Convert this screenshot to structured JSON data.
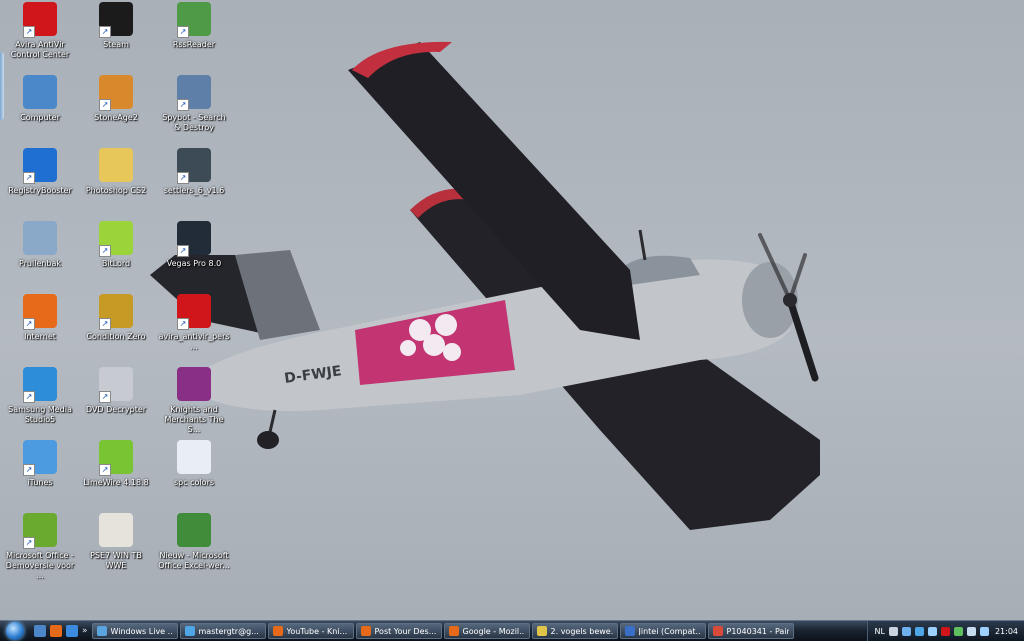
{
  "desktop": {
    "icons": [
      {
        "label": "Avira AntiVir Control Center",
        "icon": "avira-umbrella-icon",
        "color": "#d0151b",
        "shortcut": true
      },
      {
        "label": "Steam",
        "icon": "steam-icon",
        "color": "#1b1b1b",
        "shortcut": true
      },
      {
        "label": "RssReader",
        "icon": "rss-reader-icon",
        "color": "#4f9a46",
        "shortcut": true
      },
      {
        "label": "Computer",
        "icon": "computer-icon",
        "color": "#4b88c9",
        "shortcut": false
      },
      {
        "label": "StoneAge2",
        "icon": "stoneage-icon",
        "color": "#d9892b",
        "shortcut": true
      },
      {
        "label": "Spybot - Search & Destroy",
        "icon": "spybot-icon",
        "color": "#5e7fa7",
        "shortcut": true
      },
      {
        "label": "RegistryBooster",
        "icon": "registry-booster-icon",
        "color": "#1e6fd1",
        "shortcut": true
      },
      {
        "label": "Photoshop CS2",
        "icon": "folder-icon",
        "color": "#e8c75a",
        "shortcut": false
      },
      {
        "label": "settlers_6_v1.6",
        "icon": "settlers-shield-icon",
        "color": "#3d4b57",
        "shortcut": true
      },
      {
        "label": "Prullenbak",
        "icon": "recycle-bin-icon",
        "color": "#8aa8c8",
        "shortcut": false
      },
      {
        "label": "BitLord",
        "icon": "bitlord-icon",
        "color": "#9ad43a",
        "shortcut": true
      },
      {
        "label": "Vegas Pro 8.0",
        "icon": "vegas-icon",
        "color": "#222c38",
        "shortcut": true
      },
      {
        "label": "Internet",
        "icon": "firefox-icon",
        "color": "#e66a1a",
        "shortcut": true
      },
      {
        "label": "Condition Zero",
        "icon": "counter-strike-icon",
        "color": "#c79a25",
        "shortcut": true
      },
      {
        "label": "avira_antivir_pers...",
        "icon": "avira-umbrella-icon",
        "color": "#d0151b",
        "shortcut": true
      },
      {
        "label": "Samsung Media Studio5",
        "icon": "samsung-media-icon",
        "color": "#2d8dd8",
        "shortcut": true
      },
      {
        "label": "DVD Decrypter",
        "icon": "dvd-icon",
        "color": "#c7cbd1",
        "shortcut": true
      },
      {
        "label": "Knights and Merchants The S...",
        "icon": "winrar-archive-icon",
        "color": "#8a2f86",
        "shortcut": false
      },
      {
        "label": "iTunes",
        "icon": "itunes-icon",
        "color": "#4c9be0",
        "shortcut": true
      },
      {
        "label": "LimeWire 4.18.8",
        "icon": "limewire-icon",
        "color": "#79c432",
        "shortcut": true
      },
      {
        "label": "spc colors",
        "icon": "text-document-icon",
        "color": "#e9eef5",
        "shortcut": false
      },
      {
        "label": "Microsoft Office - Demoversie voor ...",
        "icon": "office-icon",
        "color": "#6aaa2f",
        "shortcut": true
      },
      {
        "label": "PSE7 WIN TB WWE",
        "icon": "adobe-box-icon",
        "color": "#e6e3dc",
        "shortcut": false
      },
      {
        "label": "Nieuw - Microsoft Office Excel-wer...",
        "icon": "excel-icon",
        "color": "#3f8d3a",
        "shortcut": false
      }
    ]
  },
  "wallpaper": {
    "subject": "biplane",
    "registration": "D-FWJE",
    "colors": {
      "sky": "#aeb4bb",
      "fuselage": "#c3c7cb",
      "wing": "#2a2a30",
      "wingtip": "#c0303c",
      "livery": "#c23572"
    }
  },
  "taskbar": {
    "quick_launch": [
      {
        "icon": "show-desktop-icon",
        "color": "#4b86c8"
      },
      {
        "icon": "firefox-icon",
        "color": "#e66a1a"
      },
      {
        "icon": "internet-explorer-icon",
        "color": "#3a8be0"
      }
    ],
    "overflow": "»",
    "tasks": [
      {
        "label": "Windows Live ...",
        "icon": "msn-icon",
        "color": "#5aa5e0"
      },
      {
        "label": "mastergtr@g...",
        "icon": "msn-icon",
        "color": "#4fa6e6"
      },
      {
        "label": "YouTube - Kni...",
        "icon": "firefox-icon",
        "color": "#e66a1a"
      },
      {
        "label": "Post Your Des...",
        "icon": "firefox-icon",
        "color": "#e66a1a"
      },
      {
        "label": "Google - Mozil...",
        "icon": "firefox-icon",
        "color": "#e66a1a"
      },
      {
        "label": "2. vogels bewe...",
        "icon": "word-document-icon",
        "color": "#e0c44a"
      },
      {
        "label": "Jintei (Compat...",
        "icon": "word-icon",
        "color": "#3a6fc7"
      },
      {
        "label": "P1040341 - Paint",
        "icon": "paint-icon",
        "color": "#d84a3a"
      }
    ],
    "tray": {
      "language": "NL",
      "icons": [
        {
          "icon": "keyboard-icon",
          "color": "#c9d4e0"
        },
        {
          "icon": "arrow-icon",
          "color": "#6fb0ef"
        },
        {
          "icon": "msn-tray-icon",
          "color": "#4fa6e6"
        },
        {
          "icon": "network-icon",
          "color": "#9bd0ff"
        },
        {
          "icon": "avira-tray-icon",
          "color": "#d0151b"
        },
        {
          "icon": "antivirus-tray-icon",
          "color": "#5ec05e"
        },
        {
          "icon": "volume-icon",
          "color": "#c8dcf0"
        },
        {
          "icon": "network-tray-icon",
          "color": "#9bd0ff"
        }
      ],
      "clock": "21:04"
    }
  }
}
